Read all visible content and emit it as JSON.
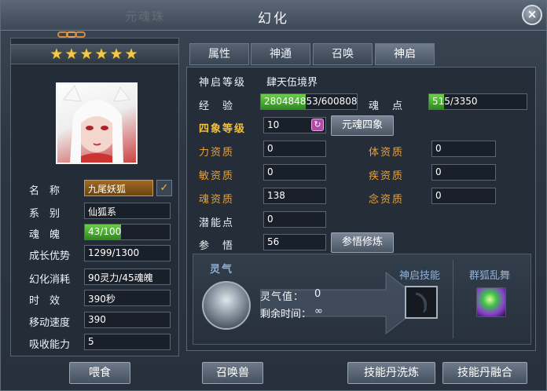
{
  "window": {
    "title": "幻化",
    "ghost_title": "元魂珠",
    "close_label": "×"
  },
  "pet": {
    "stars": "★★★★★★",
    "stats": [
      {
        "label": "名　称",
        "value": "九尾妖狐"
      },
      {
        "label": "系　别",
        "value": "仙狐系"
      },
      {
        "label": "魂　魄",
        "value": "43/100",
        "progress": 0.43
      },
      {
        "label": "成长优势",
        "value": "1299/1300"
      },
      {
        "label": "幻化消耗",
        "value": "90灵力/45魂魄"
      },
      {
        "label": "时　效",
        "value": "390秒"
      },
      {
        "label": "移动速度",
        "value": "390"
      },
      {
        "label": "吸收能力",
        "value": "5"
      }
    ],
    "check_mark": "✓"
  },
  "tabs": [
    {
      "label": "属性",
      "active": false
    },
    {
      "label": "神通",
      "active": false
    },
    {
      "label": "召唤",
      "active": false
    },
    {
      "label": "神启",
      "active": true
    }
  ],
  "shenqi": {
    "level_label": "神启等级",
    "level_value": "肆天伍境界",
    "exp_label": "经　验",
    "exp_value": "280484853/600808726",
    "exp_progress": 0.47,
    "soul_label": "魂　点",
    "soul_value": "515/3350",
    "soul_progress": 0.15,
    "sixiang_label": "四象等级",
    "sixiang_value": "10",
    "sixiang_button": "元魂四象",
    "refresh_icon": "↻",
    "attrs_left": [
      {
        "label": "力资质",
        "value": "0"
      },
      {
        "label": "敏资质",
        "value": "0"
      },
      {
        "label": "魂资质",
        "value": "138"
      }
    ],
    "attrs_right": [
      {
        "label": "体资质",
        "value": "0"
      },
      {
        "label": "疾资质",
        "value": "0"
      },
      {
        "label": "念资质",
        "value": "0"
      }
    ],
    "potential_label": "潜能点",
    "potential_value": "0",
    "wisdom_label": "参　悟",
    "wisdom_value": "56",
    "wisdom_button": "参悟修炼",
    "qi_title": "灵气",
    "qi_value_label": "灵气值：",
    "qi_value": "0",
    "qi_time_label": "剩余时间：",
    "qi_time_value": "∞",
    "skill_title": "神启技能",
    "extra_skill_name": "群狐乱舞"
  },
  "buttons": {
    "feed": "喂食",
    "summon": "召唤兽",
    "skill_wash": "技能丹洗炼",
    "skill_merge": "技能丹融合"
  }
}
